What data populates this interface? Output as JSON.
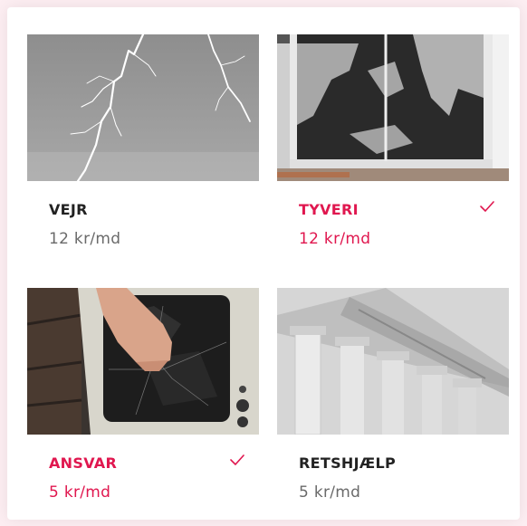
{
  "cards": [
    {
      "title": "VEJR",
      "price": "12 kr/md",
      "selected": false,
      "image": "lightning-photo"
    },
    {
      "title": "TYVERI",
      "price": "12 kr/md",
      "selected": true,
      "image": "broken-window-photo"
    },
    {
      "title": "ANSVAR",
      "price": "5 kr/md",
      "selected": true,
      "image": "broken-tv-photo"
    },
    {
      "title": "RETSHJÆLP",
      "price": "5 kr/md",
      "selected": false,
      "image": "courthouse-photo"
    }
  ],
  "colors": {
    "accent": "#e0174f",
    "text": "#222222",
    "muted": "#6a6a6a",
    "background": "#fdeef2"
  },
  "icons": {
    "check": "checkmark-icon"
  }
}
